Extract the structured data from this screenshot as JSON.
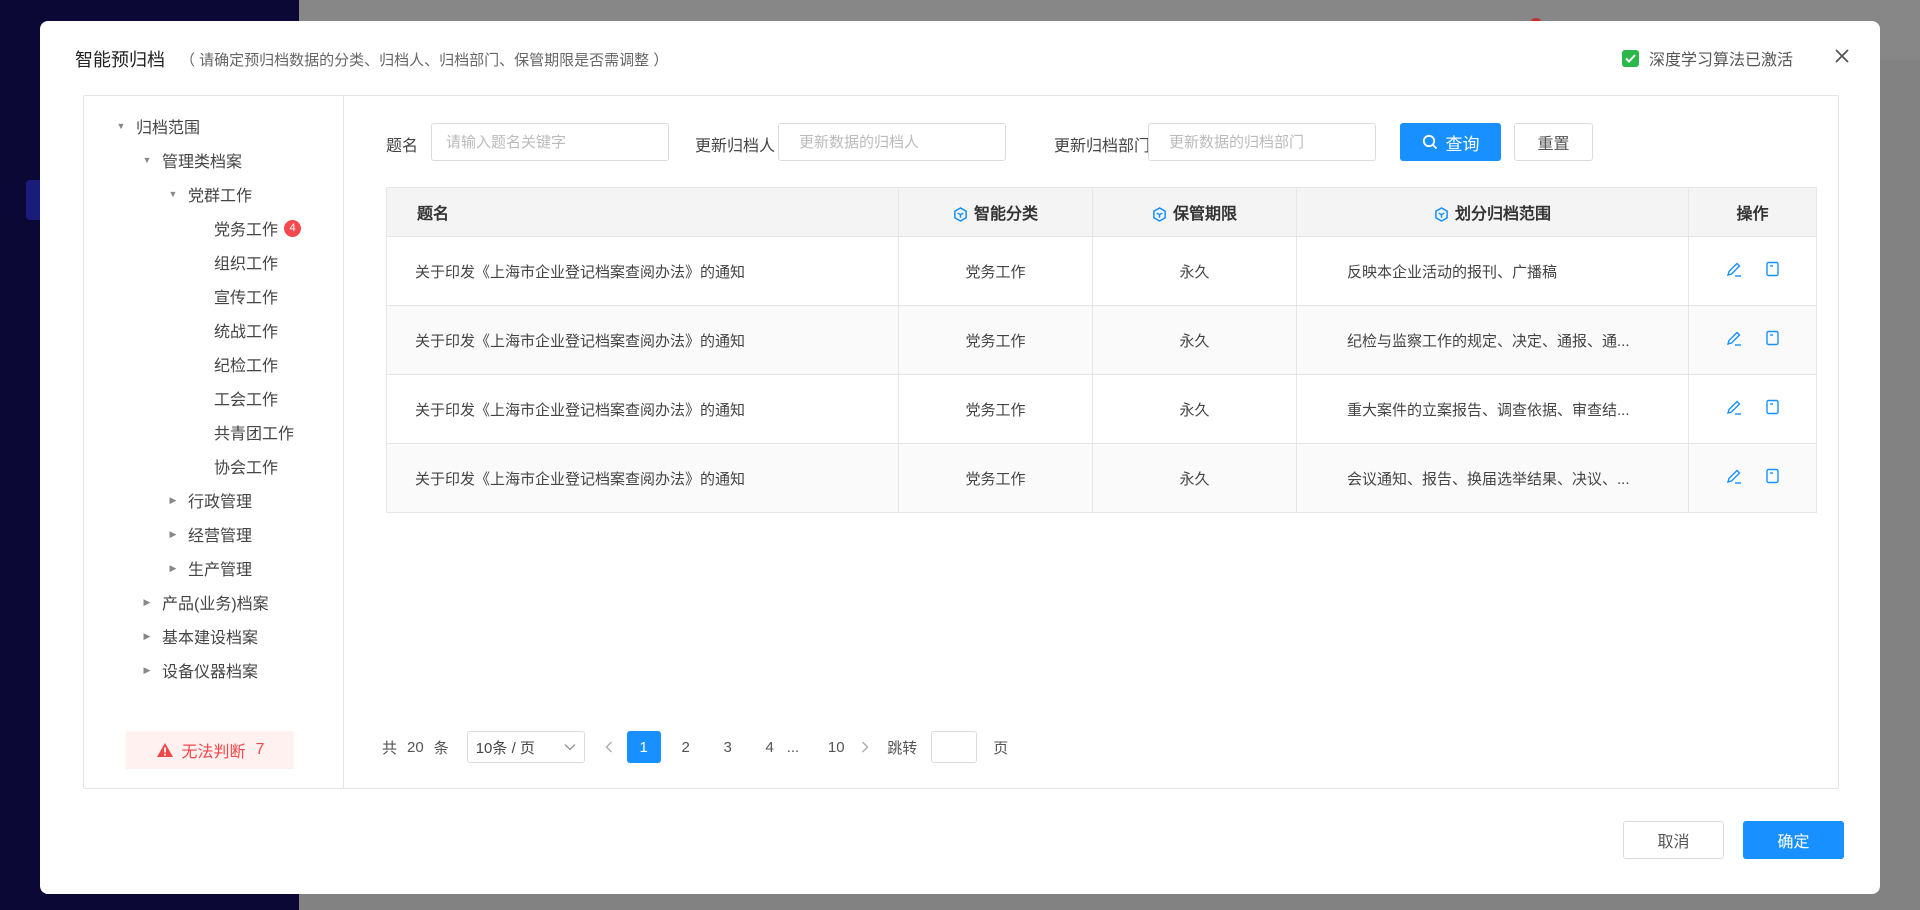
{
  "modal": {
    "title": "智能预归档",
    "subtitle": "（ 请确定预归档数据的分类、归档人、归档部门、保管期限是否需调整 ）",
    "ai_status_label": "深度学习算法已激活",
    "accent_color": "#1890ff",
    "check_color": "#2ab84a"
  },
  "tree": {
    "root": "归档范围",
    "level1_a": "管理类档案",
    "level2_a": "党群工作",
    "leaf_1": "党务工作",
    "leaf_1_badge": "4",
    "leaf_2": "组织工作",
    "leaf_3": "宣传工作",
    "leaf_4": "统战工作",
    "leaf_5": "纪检工作",
    "leaf_6": "工会工作",
    "leaf_7": "共青团工作",
    "leaf_8": "协会工作",
    "level2_b": "行政管理",
    "level2_c": "经营管理",
    "level2_d": "生产管理",
    "level1_b": "产品(业务)档案",
    "level1_c": "基本建设档案",
    "level1_d": "设备仪器档案",
    "warning_label": "无法判断",
    "warning_count": "7"
  },
  "filters": {
    "title_label": "题名",
    "title_placeholder": "请输入题名关键字",
    "person_label": "更新归档人",
    "person_placeholder": "更新数据的归档人",
    "dept_label": "更新归档部门",
    "dept_placeholder": "更新数据的归档部门",
    "search_label": "查询",
    "reset_label": "重置"
  },
  "table": {
    "headers": {
      "title": "题名",
      "category": "智能分类",
      "retention": "保管期限",
      "scope": "划分归档范围",
      "actions": "操作"
    },
    "rows": [
      {
        "title": "关于印发《上海市企业登记档案查阅办法》的通知",
        "category": "党务工作",
        "retention": "永久",
        "scope": "反映本企业活动的报刊、广播稿"
      },
      {
        "title": "关于印发《上海市企业登记档案查阅办法》的通知",
        "category": "党务工作",
        "retention": "永久",
        "scope": "纪检与监察工作的规定、决定、通报、通..."
      },
      {
        "title": "关于印发《上海市企业登记档案查阅办法》的通知",
        "category": "党务工作",
        "retention": "永久",
        "scope": "重大案件的立案报告、调查依据、审查结..."
      },
      {
        "title": "关于印发《上海市企业登记档案查阅办法》的通知",
        "category": "党务工作",
        "retention": "永久",
        "scope": "会议通知、报告、换届选举结果、决议、..."
      }
    ]
  },
  "pager": {
    "total_prefix": "共",
    "total": "20",
    "total_suffix": "条",
    "page_size": "10条 / 页",
    "pages": [
      "1",
      "2",
      "3",
      "4"
    ],
    "ellipsis": "...",
    "last_page": "10",
    "jump_label": "跳转",
    "page_unit": "页"
  },
  "footer": {
    "cancel_label": "取消",
    "ok_label": "确定"
  }
}
